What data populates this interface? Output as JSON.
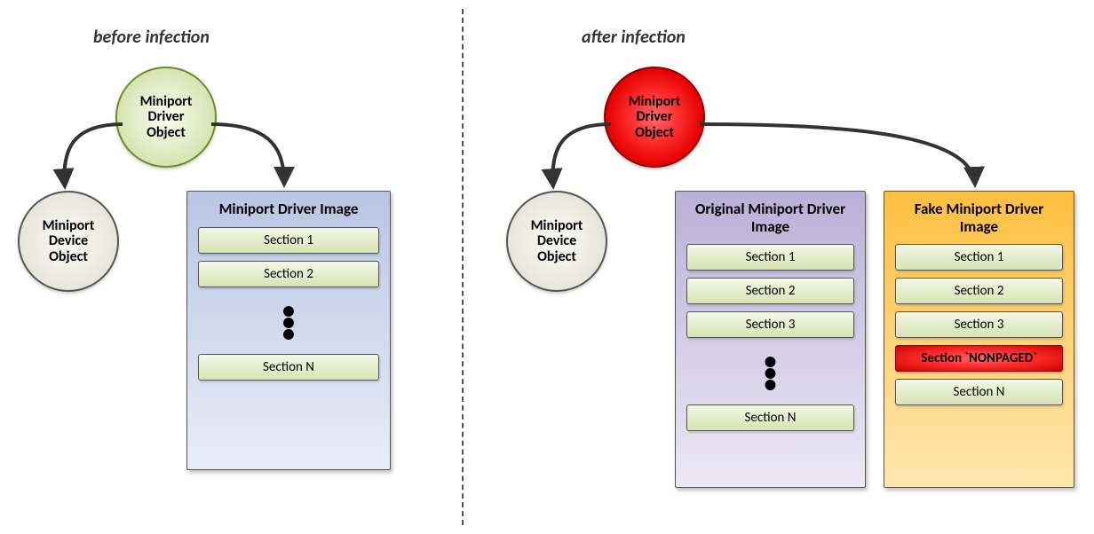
{
  "titles": {
    "before": "before infection",
    "after": "after infection"
  },
  "before": {
    "driver_object": "Miniport\nDriver\nObject",
    "device_object": "Miniport\nDevice\nObject",
    "panel_title": "Miniport Driver Image",
    "sections": {
      "s1": "Section 1",
      "s2": "Section 2",
      "sN": "Section N"
    }
  },
  "after": {
    "driver_object": "Miniport\nDriver\nObject",
    "device_object": "Miniport\nDevice\nObject",
    "panel_original_title": "Original Miniport Driver Image",
    "panel_fake_title": "Fake Miniport Driver Image",
    "original_sections": {
      "s1": "Section 1",
      "s2": "Section 2",
      "s3": "Section 3",
      "sN": "Section N"
    },
    "fake_sections": {
      "s1": "Section 1",
      "s2": "Section 2",
      "s3": "Section 3",
      "nonpaged": "Section `NONPAGED`",
      "sN": "Section N"
    }
  }
}
